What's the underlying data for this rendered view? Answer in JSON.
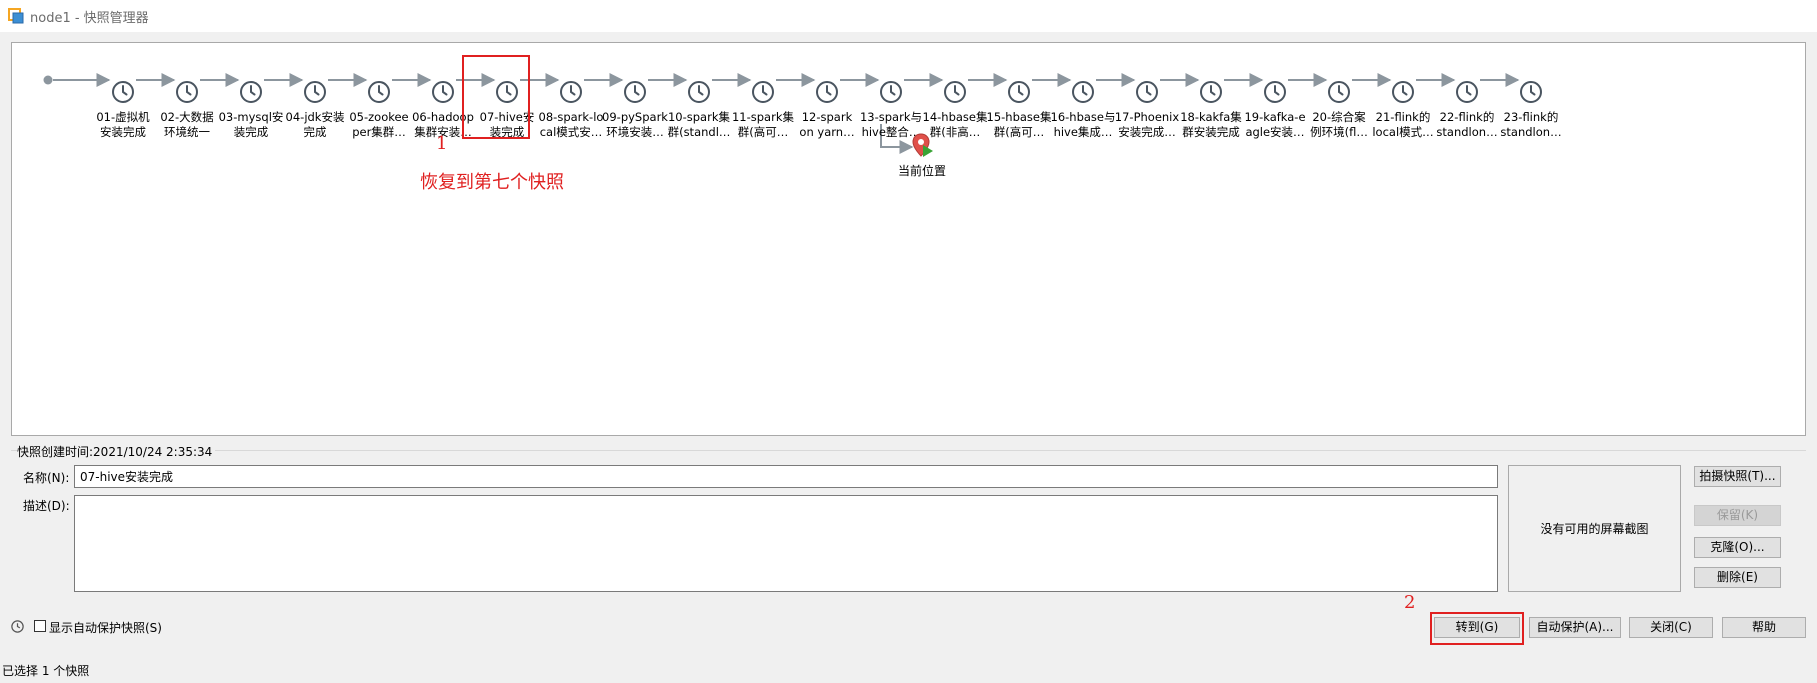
{
  "window": {
    "title": "node1 - 快照管理器",
    "icon": "vmware-icon"
  },
  "tree": {
    "root_icon": "root-dot-icon",
    "snapshot_icon": "clock-icon",
    "snapshots": [
      {
        "id": "01",
        "label_lines": [
          "01-虚拟机",
          "安装完成"
        ]
      },
      {
        "id": "02",
        "label_lines": [
          "02-大数据",
          "环境统一"
        ]
      },
      {
        "id": "03",
        "label_lines": [
          "03-mysql安",
          "装完成"
        ]
      },
      {
        "id": "04",
        "label_lines": [
          "04-jdk安装",
          "完成"
        ]
      },
      {
        "id": "05",
        "label_lines": [
          "05-zookee",
          "per集群…"
        ]
      },
      {
        "id": "06",
        "label_lines": [
          "06-hadoop",
          "集群安装…"
        ]
      },
      {
        "id": "07",
        "label_lines": [
          "07-hive安",
          "装完成"
        ],
        "selected": true
      },
      {
        "id": "08",
        "label_lines": [
          "08-spark-lo",
          "cal模式安…"
        ]
      },
      {
        "id": "09",
        "label_lines": [
          "09-pySpark",
          "环境安装…"
        ]
      },
      {
        "id": "10",
        "label_lines": [
          "10-spark集",
          "群(standl…"
        ]
      },
      {
        "id": "11",
        "label_lines": [
          "11-spark集",
          "群(高可…"
        ]
      },
      {
        "id": "12",
        "label_lines": [
          "12-spark",
          "on yarn…"
        ]
      },
      {
        "id": "13",
        "label_lines": [
          "13-spark与",
          "hive整合…"
        ]
      },
      {
        "id": "14",
        "label_lines": [
          "14-hbase集",
          "群(非高…"
        ]
      },
      {
        "id": "15",
        "label_lines": [
          "15-hbase集",
          "群(高可…"
        ]
      },
      {
        "id": "16",
        "label_lines": [
          "16-hbase与",
          "hive集成…"
        ]
      },
      {
        "id": "17",
        "label_lines": [
          "17-Phoenix",
          "安装完成…"
        ]
      },
      {
        "id": "18",
        "label_lines": [
          "18-kakfa集",
          "群安装完成"
        ]
      },
      {
        "id": "19",
        "label_lines": [
          "19-kafka-e",
          "agle安装…"
        ]
      },
      {
        "id": "20",
        "label_lines": [
          "20-综合案",
          "例环境(fl…"
        ]
      },
      {
        "id": "21",
        "label_lines": [
          "21-flink的",
          "local模式…"
        ]
      },
      {
        "id": "22",
        "label_lines": [
          "22-flink的",
          "standlon…"
        ]
      },
      {
        "id": "23",
        "label_lines": [
          "23-flink的",
          "standlon…"
        ]
      }
    ],
    "current_position": {
      "label": "当前位置",
      "icon": "current-location-pin-icon"
    }
  },
  "annotations": {
    "marker1": "1",
    "marker1_text": "恢复到第七个快照",
    "marker2": "2"
  },
  "details": {
    "created_label": "快照创建时间:2021/10/24 2:35:34",
    "name_label": "名称(N):",
    "name_value": "07-hive安装完成",
    "desc_label": "描述(D):",
    "desc_value": "",
    "no_screenshot": "没有可用的屏幕截图"
  },
  "actions": {
    "take_snapshot": "拍摄快照(T)...",
    "keep": "保留(K)",
    "clone": "克隆(O)...",
    "delete": "删除(E)"
  },
  "footer": {
    "show_autoprotect_label": "显示自动保护快照(S)",
    "show_autoprotect_checked": false,
    "goto": "转到(G)",
    "autoprotect": "自动保护(A)...",
    "close": "关闭(C)",
    "help": "帮助"
  },
  "status": "已选择 1 个快照",
  "colors": {
    "annotation": "#e02020",
    "clock": "#4a5560",
    "arrow": "#8c969e",
    "pin": "#e0504a",
    "play": "#3aa335"
  }
}
